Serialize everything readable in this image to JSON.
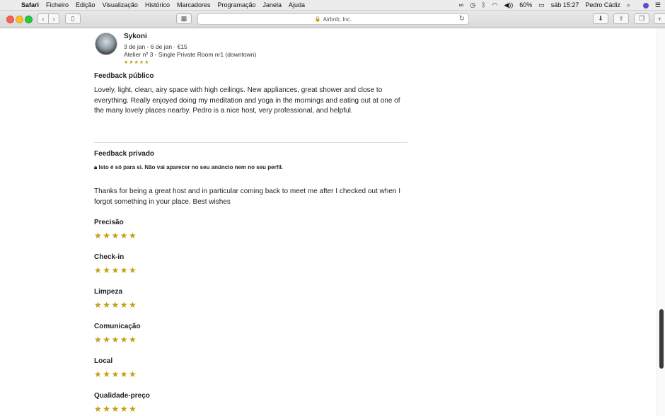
{
  "menubar": {
    "items": [
      "Safari",
      "Ficheiro",
      "Edição",
      "Visualização",
      "Histórico",
      "Marcadores",
      "Programação",
      "Janela",
      "Ajuda"
    ],
    "battery": "60%",
    "clock": "sáb 15:27",
    "user": "Pedro Cádiz"
  },
  "toolbar": {
    "address": "Airbnb, Inc."
  },
  "review": {
    "reviewer": "Sykoni",
    "meta": "3 de jan - 6 de jan · €15",
    "listing": "Atelier nº 3 - Single Private Room nr1 (downtown)",
    "rating_stars": "★★★★★",
    "public_heading": "Feedback público",
    "public_text": "Lovely, light, clean, airy space with high ceilings. New appliances, great shower and close to everything. Really enjoyed doing my meditation and yoga in the mornings and eating out at one of the many lovely places nearby. Pedro is a nice host, very professional, and helpful.",
    "private_heading": "Feedback privado",
    "private_note": "Isto é só para si. Não vai aparecer no seu anúncio nem no seu perfil.",
    "private_text": "Thanks for being a great host and in particular coming back to meet me after I checked out when I forgot something in your place. Best wishes",
    "categories": [
      {
        "label": "Precisão",
        "stars": "★★★★★",
        "rating": 5
      },
      {
        "label": "Check-in",
        "stars": "★★★★★",
        "rating": 5
      },
      {
        "label": "Limpeza",
        "stars": "★★★★★",
        "rating": 5
      },
      {
        "label": "Comunicação",
        "stars": "★★★★★",
        "rating": 5
      },
      {
        "label": "Local",
        "stars": "★★★★★",
        "rating": 5
      },
      {
        "label": "Qualidade-preço",
        "stars": "★★★★★",
        "rating": 5
      }
    ]
  },
  "icons": {
    "lock": "lock-icon",
    "star_color": "#c49d10"
  }
}
